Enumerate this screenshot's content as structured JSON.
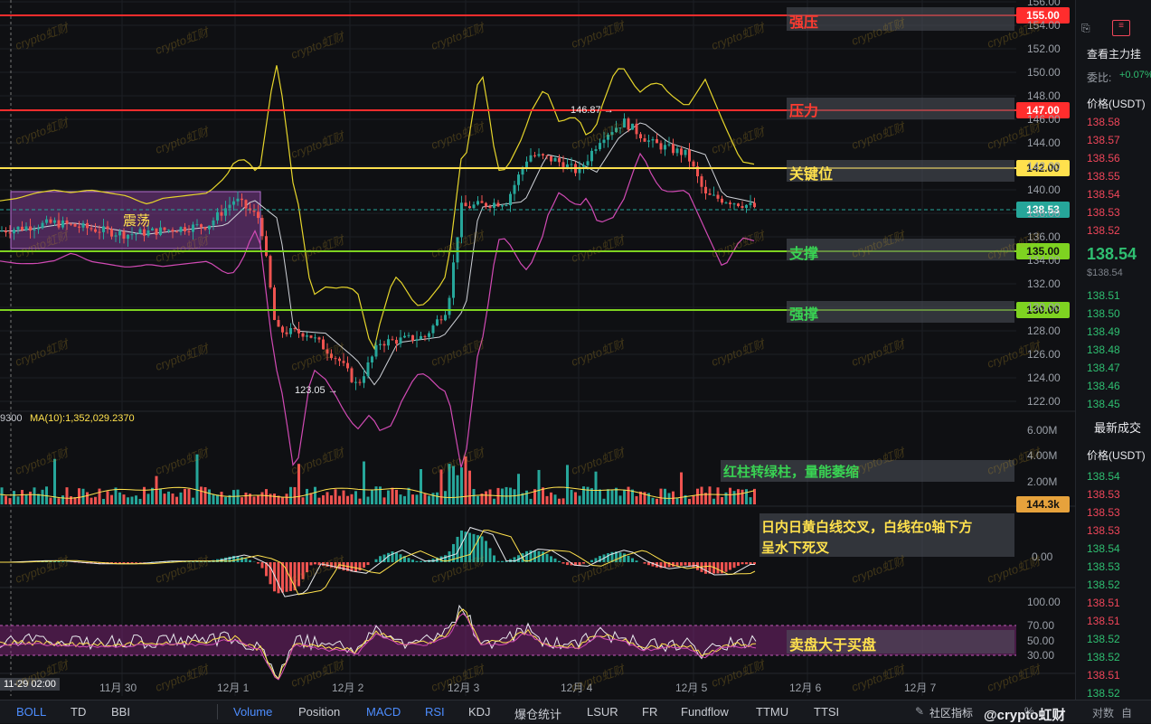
{
  "chart": {
    "price_axis_ticks": [
      "156.00",
      "154.00",
      "152.00",
      "150.00",
      "148.00",
      "146.00",
      "144.00",
      "142.00",
      "140.00",
      "138.00",
      "136.00",
      "134.00",
      "132.00",
      "130.00",
      "128.00",
      "126.00",
      "124.00",
      "122.00"
    ],
    "volume_axis_ticks": [
      "6.00M",
      "4.00M",
      "2.00M"
    ],
    "macd_axis_ticks": [
      "0.00"
    ],
    "rsi_axis_ticks": [
      "100.00",
      "70.00",
      "50.00",
      "30.00"
    ],
    "x_labels": [
      "11月 30",
      "12月 1",
      "12月 2",
      "12月 3",
      "12月 4",
      "12月 5",
      "12月 6",
      "12月 7"
    ],
    "crosshair_time": "11-29 02:00",
    "high_marker": "146.87 →",
    "low_marker": "123.05 →",
    "ma_label": "MA(10):1,352,029.2370",
    "ma_prefix": "9300",
    "range_label": "震荡",
    "price_tags": {
      "strong_resist": "155.00",
      "resist": "147.00",
      "key": "142.00",
      "current": "138.53",
      "support": "135.00",
      "strong_support": "130.00",
      "volume": "144.3k"
    },
    "annotations": {
      "strong_resist": "强压",
      "resist": "压力",
      "key": "关键位",
      "support": "支撑",
      "strong_support": "强撑",
      "volume_note": "红柱转绿柱，量能萎缩",
      "macd_note_1": "日内日黄白线交叉，白线在0轴下方",
      "macd_note_2": "呈水下死叉",
      "rsi_note": "卖盘大于买盘"
    },
    "watermark": "crypto虹财",
    "colors": {
      "up": "#26a69a",
      "down": "#ef5350",
      "red_line": "#ff2d2d",
      "yellow_line": "#ffe14d",
      "green_line": "#7ed321"
    }
  },
  "right_panel": {
    "top_label": "查看主力挂",
    "ratio_label": "委比:",
    "ratio_value": "+0.07%",
    "price_header": "价格(USDT)",
    "asks": [
      "138.58",
      "138.57",
      "138.56",
      "138.55",
      "138.54",
      "138.53",
      "138.52"
    ],
    "last_price": "138.54",
    "last_price_usd": "$138.54",
    "bids": [
      "138.51",
      "138.50",
      "138.49",
      "138.48",
      "138.47",
      "138.46",
      "138.45"
    ],
    "trades_title": "最新成交",
    "trades_header": "价格(USDT)",
    "trades": [
      {
        "p": "138.54",
        "s": "up"
      },
      {
        "p": "138.53",
        "s": "dn"
      },
      {
        "p": "138.53",
        "s": "dn"
      },
      {
        "p": "138.53",
        "s": "dn"
      },
      {
        "p": "138.54",
        "s": "up"
      },
      {
        "p": "138.53",
        "s": "up"
      },
      {
        "p": "138.52",
        "s": "up"
      },
      {
        "p": "138.51",
        "s": "dn"
      },
      {
        "p": "138.51",
        "s": "dn"
      },
      {
        "p": "138.52",
        "s": "up"
      },
      {
        "p": "138.52",
        "s": "up"
      },
      {
        "p": "138.51",
        "s": "dn"
      },
      {
        "p": "138.52",
        "s": "up"
      }
    ]
  },
  "toolbar": {
    "left_items": [
      "BOLL",
      "TD",
      "BBI"
    ],
    "items": [
      "Volume",
      "Position",
      "MACD",
      "RSI",
      "KDJ",
      "爆仓统计",
      "LSUR",
      "FR",
      "Fundflow",
      "TTMU",
      "TTSI"
    ],
    "community": "社区指标",
    "pct": "%",
    "log": "对数",
    "auto": "自",
    "brand": "@crypto虹财"
  }
}
